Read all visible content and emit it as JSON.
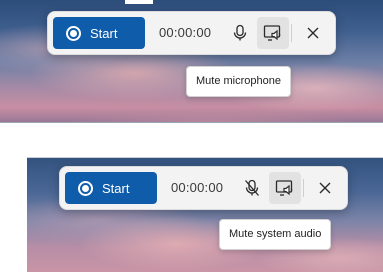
{
  "top_toolbar": {
    "start_label": "Start",
    "timer": "00:00:00",
    "microphone_state": "unmuted",
    "tooltip": "Mute microphone"
  },
  "bottom_toolbar": {
    "start_label": "Start",
    "timer": "00:00:00",
    "microphone_state": "muted",
    "tooltip": "Mute system audio"
  },
  "icons": {
    "record": "record-icon",
    "microphone": "microphone-icon",
    "microphone_muted": "microphone-muted-icon",
    "system_audio": "system-audio-icon",
    "close": "close-icon"
  },
  "colors": {
    "accent": "#0f5caa",
    "toolbar_bg": "#f3f3f3",
    "tooltip_bg": "#ffffff"
  }
}
